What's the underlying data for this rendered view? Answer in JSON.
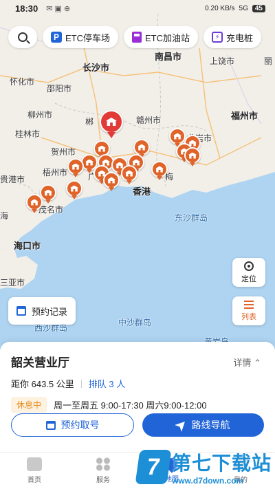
{
  "status_bar": {
    "time": "18:30",
    "net_speed": "0.20 KB/s",
    "signal": "5G",
    "battery": "45"
  },
  "filters": [
    {
      "label": "ETC停车场",
      "icon": "parking-icon"
    },
    {
      "label": "ETC加油站",
      "icon": "fuel-icon"
    },
    {
      "label": "充电桩",
      "icon": "charging-icon"
    }
  ],
  "map": {
    "cities": [
      "南昌市",
      "长沙市",
      "上饶市",
      "怀化市",
      "邵阳市",
      "赣州市",
      "福州市",
      "柳州市",
      "桂林市",
      "贺州市",
      "梧州市",
      "贵港市",
      "龙岩市",
      "梅",
      "香港",
      "茂名市",
      "东沙群岛",
      "海口市",
      "海",
      "三亚市",
      "西沙群岛",
      "中沙群岛",
      "黄岩岛",
      "郴",
      "广",
      "丽"
    ]
  },
  "controls": {
    "locate_label": "定位",
    "list_label": "列表",
    "booking_records_label": "预约记录"
  },
  "station": {
    "name": "韶关营业厅",
    "detail_label": "详情",
    "distance": "距你 643.5 公里",
    "queue": "排队 3 人",
    "status": "休息中",
    "hours": "周一至周五 9:00-17:30 周六9:00-12:00",
    "book_button": "预约取号",
    "navigate_button": "路线导航"
  },
  "tabs": [
    {
      "label": "首页"
    },
    {
      "label": "服务"
    },
    {
      "label": "地图"
    },
    {
      "label": "我的"
    }
  ],
  "watermark": {
    "logo": "7",
    "title": "第七下载站",
    "url": "www.d7down.com"
  }
}
